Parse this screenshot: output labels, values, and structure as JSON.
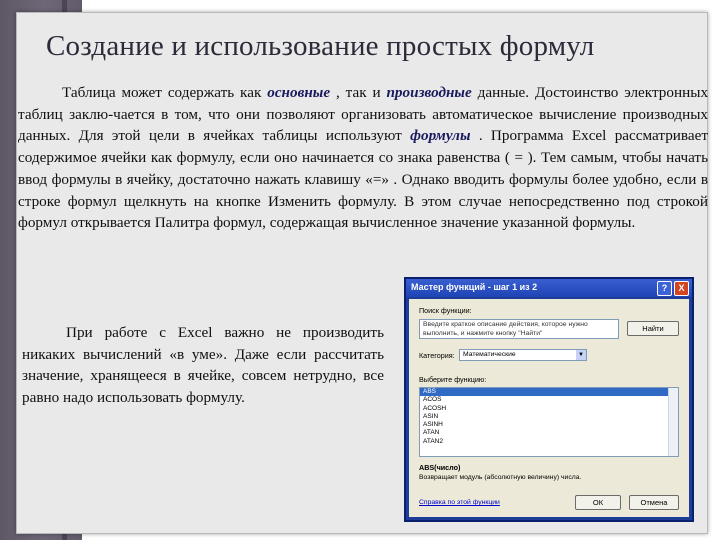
{
  "slide": {
    "title": "Создание и использование простых формул",
    "paragraph1": {
      "t1": "Таблица может содержать как",
      "em1": "основные",
      "t2": ", так и",
      "em2": "производные",
      "t3": "данные. Достоинство электронных таблиц заклю-чается в том, что они позволяют организовать автоматическое вычисление производных данных. Для этой цели в ячейках таблицы используют",
      "em3": "формулы",
      "t4": ". Программа Excel рассматривает содержимое ячейки как формулу, если оно начинается со знака равенства ( = ). Тем самым, чтобы начать ввод формулы в ячейку, достаточно нажать клавишу «=» . Однако вводить формулы более удобно, если в строке формул щелкнуть на кнопке Изменить формулу. В этом случае непосредственно под строкой формул открывается Палитра формул, содержащая вычисленное значение указанной формулы."
    },
    "paragraph2": "При работе с Excel важно не производить никаких вычислений «в уме». Даже если рассчитать значение, хранящееся в ячейке, совсем нетрудно, все равно надо использовать формулу."
  },
  "dialog": {
    "title": "Мастер функций - шаг 1 из 2",
    "help_glyph": "?",
    "close_glyph": "X",
    "search_label": "Поиск функции:",
    "search_value": "Введите краткое описание действия, которое нужно выполнить, и нажмите кнопку \"Найти\"",
    "find_button": "Найти",
    "category_label": "Категория:",
    "category_value": "Математические",
    "dropdown_arrow": "▼",
    "select_label": "Выберите функцию:",
    "functions": [
      "ABS",
      "ACOS",
      "ACOSH",
      "ASIN",
      "ASINH",
      "ATAN",
      "ATAN2"
    ],
    "selected_index": 0,
    "signature": "ABS(число)",
    "description": "Возвращает модуль (абсолютную величину) числа.",
    "help_link": "Справка по этой функции",
    "ok_button": "ОК",
    "cancel_button": "Отмена"
  }
}
